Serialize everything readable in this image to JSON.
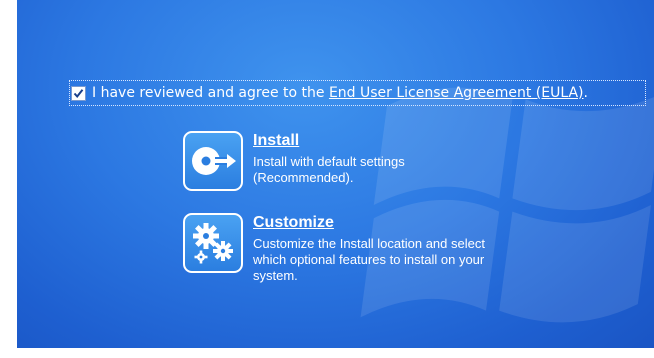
{
  "eula": {
    "checked": true,
    "prefix_text": "I have reviewed and agree to the ",
    "link_text": "End User License Agreement (EULA)",
    "suffix_text": "."
  },
  "options": [
    {
      "title": "Install",
      "description_line1": "Install with default settings",
      "description_line2": "(Recommended).",
      "icon": "disc-arrow-icon"
    },
    {
      "title": "Customize",
      "description_line1": "Customize the Install location and select",
      "description_line2": "which optional features to install on your",
      "description_line3": "system.",
      "icon": "gears-icon"
    }
  ],
  "colors": {
    "background": "#2c78e2",
    "text": "#ffffff"
  }
}
